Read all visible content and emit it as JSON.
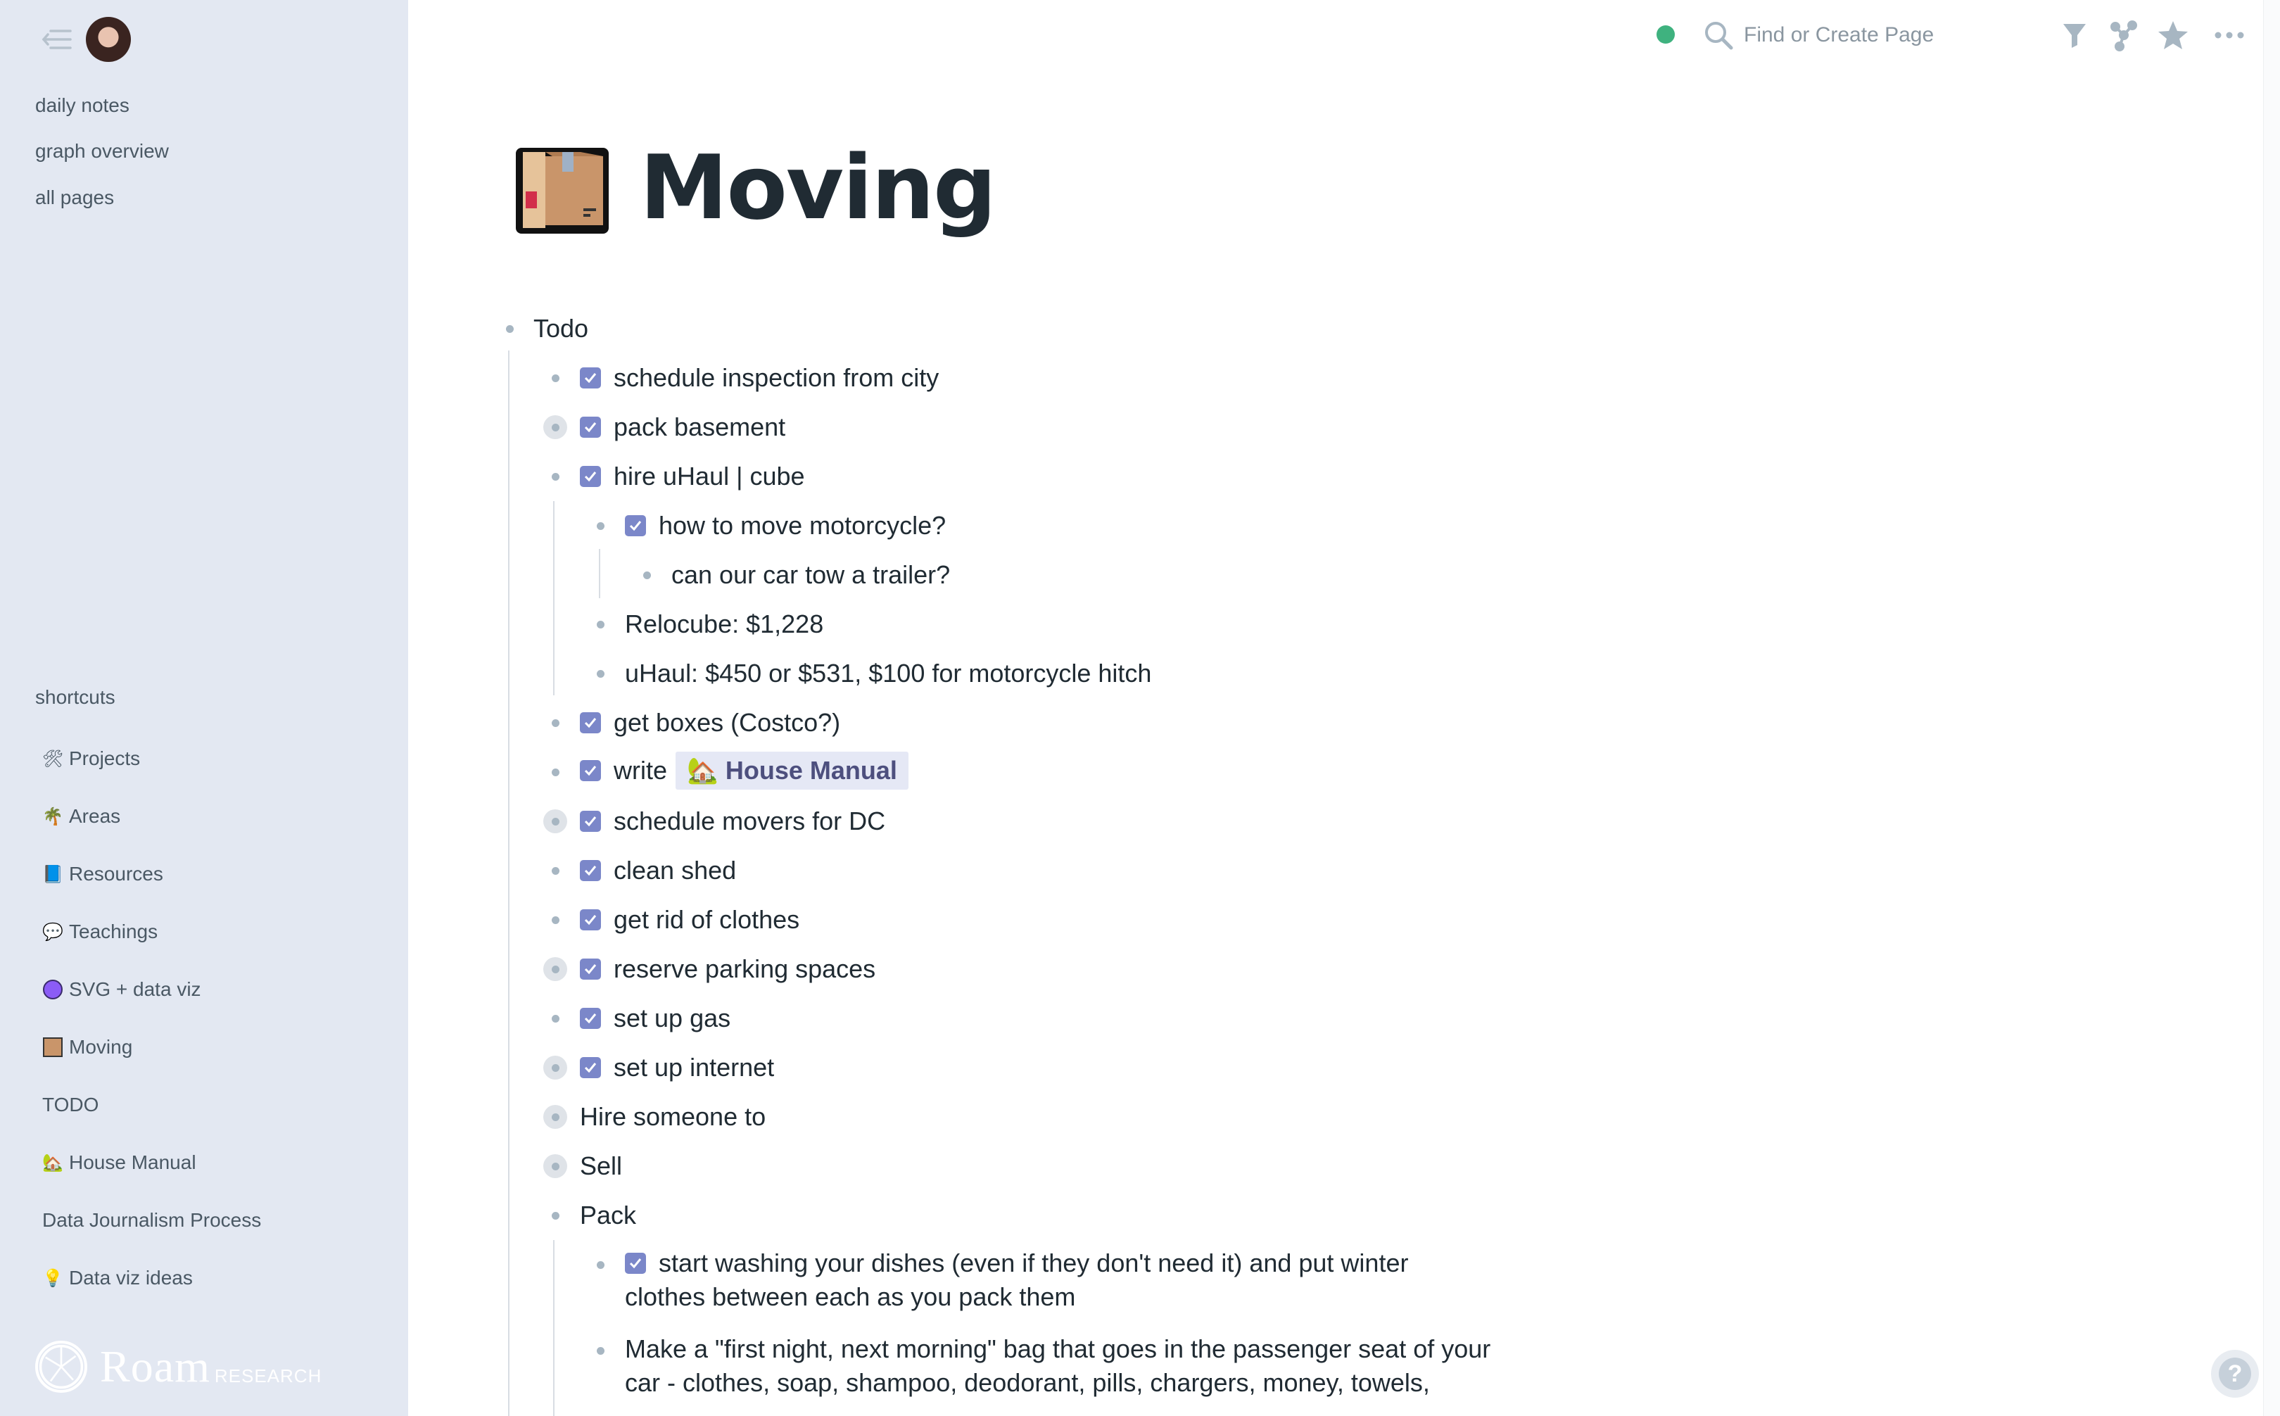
{
  "sidebar": {
    "nav": [
      "daily notes",
      "graph overview",
      "all pages"
    ],
    "shortcuts_label": "shortcuts",
    "shortcuts": [
      {
        "emoji": "🛠",
        "label": "Projects"
      },
      {
        "emoji": "🌴",
        "label": "Areas"
      },
      {
        "emoji": "📘",
        "label": "Resources"
      },
      {
        "emoji": "💬",
        "label": "Teachings"
      },
      {
        "emoji": "🟣",
        "label": "SVG + data viz"
      },
      {
        "emoji": "📦",
        "label": "Moving"
      },
      {
        "emoji": "",
        "label": "TODO"
      },
      {
        "emoji": "🏡",
        "label": "House Manual"
      },
      {
        "emoji": "",
        "label": "Data Journalism Process"
      },
      {
        "emoji": "💡",
        "label": "Data viz ideas"
      }
    ],
    "logo": {
      "word": "Roam",
      "sub": "RESEARCH"
    }
  },
  "topbar": {
    "search_placeholder": "Find or Create Page",
    "status_color": "#3fb27f"
  },
  "page": {
    "title": "Moving",
    "title_emoji": "package-icon"
  },
  "blocks": {
    "todo": "Todo",
    "b1": "schedule inspection from city",
    "b2": "pack basement",
    "b3": "hire uHaul | cube",
    "b3a": "how to move motorcycle?",
    "b3a1": "can our car tow a trailer?",
    "b3b": "Relocube: $1,228",
    "b3c": "uHaul: $450 or $531, $100 for motorcycle hitch",
    "b4": "get boxes (Costco?)",
    "b5": "write",
    "b5_ref": "House Manual",
    "b6": "schedule movers for DC",
    "b7": "clean shed",
    "b8": "get rid of clothes",
    "b9": "reserve parking spaces",
    "b10": "set up gas",
    "b11": "set up internet",
    "hire": "Hire someone to",
    "sell": "Sell",
    "pack": "Pack",
    "p1_line1": "start washing your dishes (even if they don't need it) and put winter",
    "p1_line2": "clothes between each as you pack them",
    "p2_line1": "Make a \"first night, next morning\" bag that goes in the passenger seat of your",
    "p2_line2": "car - clothes, soap, shampoo, deodorant, pills, chargers, money, towels,"
  },
  "colors": {
    "sidebar_bg": "#e3e8f2",
    "checkbox": "#7b87c9",
    "ref_chip_bg": "#e5e8f5",
    "title": "#202b33"
  },
  "help_label": "?"
}
